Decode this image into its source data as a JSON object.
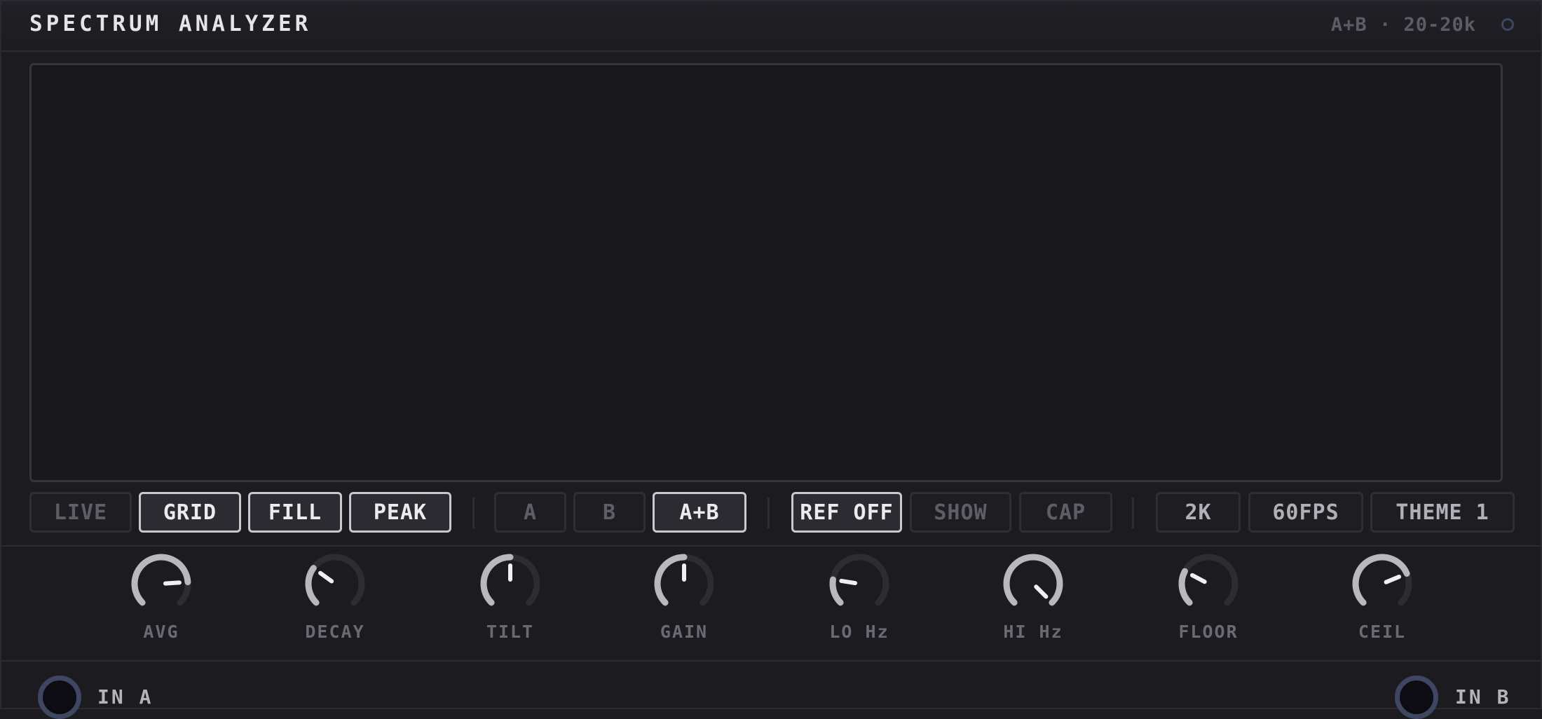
{
  "header": {
    "title": "SPECTRUM ANALYZER",
    "status": "A+B · 20-20k"
  },
  "toolbar": {
    "group1": [
      {
        "label": "LIVE",
        "active": false
      },
      {
        "label": "GRID",
        "active": true
      },
      {
        "label": "FILL",
        "active": true
      },
      {
        "label": "PEAK",
        "active": true
      }
    ],
    "group2": [
      {
        "label": "A",
        "active": false
      },
      {
        "label": "B",
        "active": false
      },
      {
        "label": "A+B",
        "active": true
      }
    ],
    "group3": [
      {
        "label": "REF OFF",
        "active": true
      },
      {
        "label": "SHOW",
        "active": false
      },
      {
        "label": "CAP",
        "active": false
      }
    ],
    "group4": [
      {
        "label": "2K"
      },
      {
        "label": "60FPS"
      },
      {
        "label": "THEME 1"
      }
    ]
  },
  "knobs": [
    {
      "label": "AVG",
      "value": 0.82
    },
    {
      "label": "DECAY",
      "value": 0.3
    },
    {
      "label": "TILT",
      "value": 0.5
    },
    {
      "label": "GAIN",
      "value": 0.5
    },
    {
      "label": "LO Hz",
      "value": 0.2
    },
    {
      "label": "HI Hz",
      "value": 1.0
    },
    {
      "label": "FLOOR",
      "value": 0.27
    },
    {
      "label": "CEIL",
      "value": 0.75
    }
  ],
  "footer": {
    "in_a": "IN A",
    "in_b": "IN B"
  },
  "colors": {
    "accent_active": "#c8c8d0",
    "jack_ring": "#3e4660"
  }
}
